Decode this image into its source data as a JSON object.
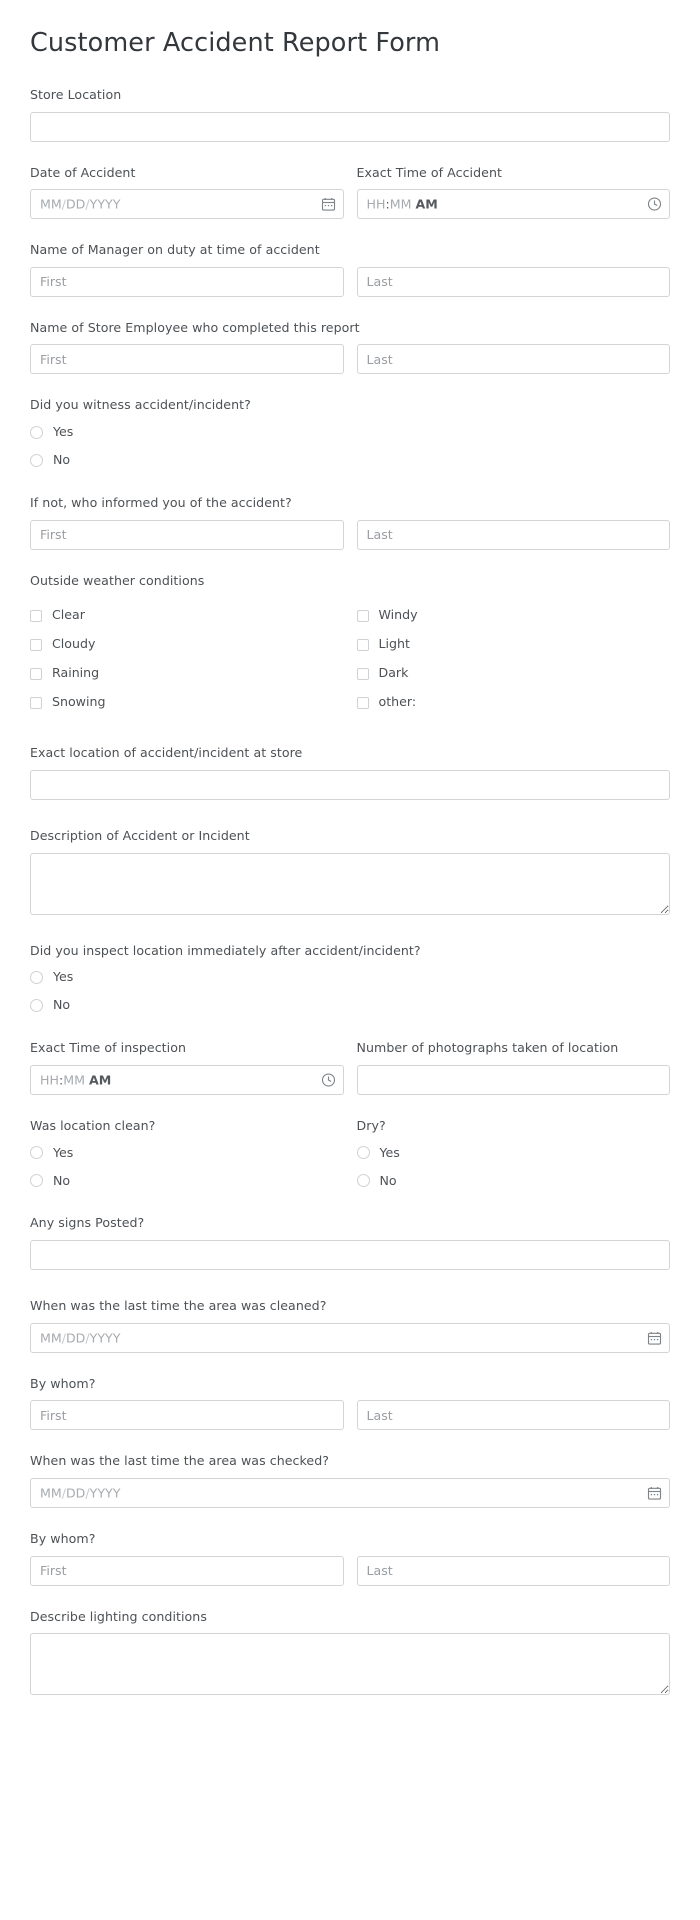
{
  "form": {
    "title": "Customer Accident Report Form",
    "name_placeholders": {
      "first": "First",
      "last": "Last"
    },
    "date_placeholder": "MM/DD/YYYY",
    "time_placeholder": "HH:MM AM",
    "time_parts": {
      "hh": "HH",
      "colon": ":",
      "mm": "MM",
      "ampm": "AM"
    },
    "date_parts": {
      "mm": "MM",
      "s1": "/",
      "dd": "DD",
      "s2": "/",
      "yyyy": "YYYY"
    },
    "yes_label": "Yes",
    "no_label": "No",
    "icons": {
      "calendar": "calendar-icon",
      "clock": "clock-icon"
    },
    "fields": {
      "store_location": {
        "label": "Store Location",
        "value": ""
      },
      "date_of_accident": {
        "label": "Date of Accident",
        "value": ""
      },
      "exact_time_of_accident": {
        "label": "Exact Time of Accident",
        "value": ""
      },
      "manager_name": {
        "label": "Name of Manager on duty at time of accident",
        "first": "",
        "last": ""
      },
      "employee_name": {
        "label": "Name of Store Employee who completed this report",
        "first": "",
        "last": ""
      },
      "did_witness": {
        "label": "Did you witness accident/incident?",
        "options": [
          "Yes",
          "No"
        ],
        "selected": ""
      },
      "informed_by": {
        "label": "If not, who informed you of the accident?",
        "first": "",
        "last": ""
      },
      "weather": {
        "label": "Outside weather conditions",
        "options_left": [
          "Clear",
          "Cloudy",
          "Raining",
          "Snowing"
        ],
        "options_right": [
          "Windy",
          "Light",
          "Dark",
          "other:"
        ],
        "checked": []
      },
      "exact_location": {
        "label": "Exact location of accident/incident at store",
        "value": ""
      },
      "description": {
        "label": "Description of Accident or Incident",
        "value": ""
      },
      "did_inspect": {
        "label": "Did you inspect location immediately after accident/incident?",
        "options": [
          "Yes",
          "No"
        ],
        "selected": ""
      },
      "time_of_inspection": {
        "label": "Exact Time of inspection",
        "value": ""
      },
      "num_photographs": {
        "label": "Number of photographs taken of location",
        "value": ""
      },
      "was_clean": {
        "label": "Was location clean?",
        "options": [
          "Yes",
          "No"
        ],
        "selected": ""
      },
      "was_dry": {
        "label": "Dry?",
        "options": [
          "Yes",
          "No"
        ],
        "selected": ""
      },
      "signs_posted": {
        "label": "Any signs Posted?",
        "value": ""
      },
      "last_cleaned": {
        "label": "When was the last time the area was cleaned?",
        "value": ""
      },
      "cleaned_by_whom": {
        "label": "By whom?",
        "first": "",
        "last": ""
      },
      "last_checked": {
        "label": "When was the last time the area was checked?",
        "value": ""
      },
      "checked_by_whom": {
        "label": "By whom?",
        "first": "",
        "last": ""
      },
      "lighting_conditions": {
        "label": "Describe lighting conditions",
        "value": ""
      }
    }
  },
  "colors": {
    "text": "#4d5155",
    "title": "#34383c",
    "border": "#d2d4d6",
    "placeholder": "#9a9ea2",
    "background": "#ffffff"
  }
}
